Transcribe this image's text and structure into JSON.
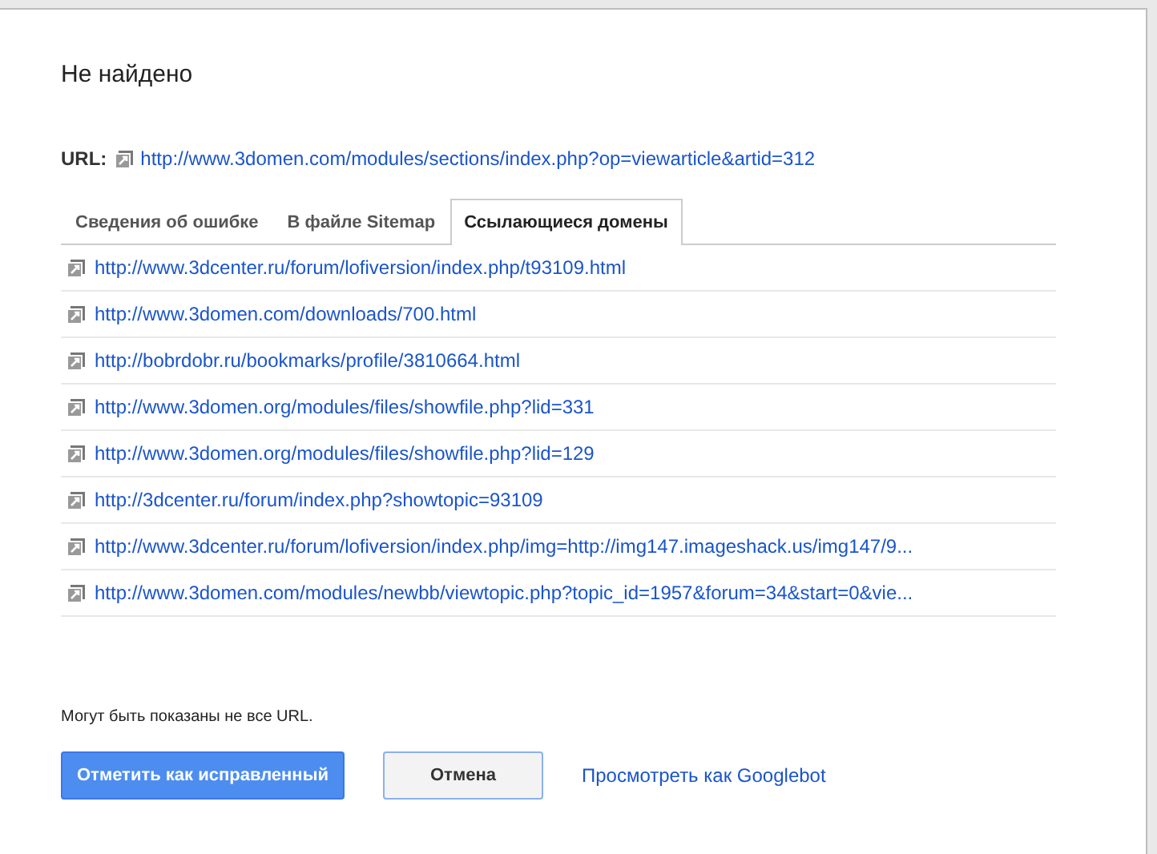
{
  "dialog": {
    "title": "Не найдено",
    "url": {
      "label": "URL:",
      "link": "http://www.3domen.com/modules/sections/index.php?op=viewarticle&artid=312"
    },
    "tabs": [
      {
        "label": "Сведения об ошибке",
        "selected": false
      },
      {
        "label": "В файле Sitemap",
        "selected": false
      },
      {
        "label": "Ссылающиеся домены",
        "selected": true
      }
    ],
    "links": [
      "http://www.3dcenter.ru/forum/lofiversion/index.php/t93109.html",
      "http://www.3domen.com/downloads/700.html",
      "http://bobrdobr.ru/bookmarks/profile/3810664.html",
      "http://www.3domen.org/modules/files/showfile.php?lid=331",
      "http://www.3domen.org/modules/files/showfile.php?lid=129",
      "http://3dcenter.ru/forum/index.php?showtopic=93109",
      "http://www.3dcenter.ru/forum/lofiversion/index.php/img=http://img147.imageshack.us/img147/9...",
      "http://www.3domen.com/modules/newbb/viewtopic.php?topic_id=1957&forum=34&start=0&vie..."
    ],
    "note": "Могут быть показаны не все URL.",
    "buttons": [
      {
        "label": "Отметить как исправленный",
        "kind": "primary"
      },
      {
        "label": "Отмена",
        "kind": "secondary"
      },
      {
        "label": "Просмотреть как Googlebot",
        "kind": "link"
      }
    ]
  }
}
